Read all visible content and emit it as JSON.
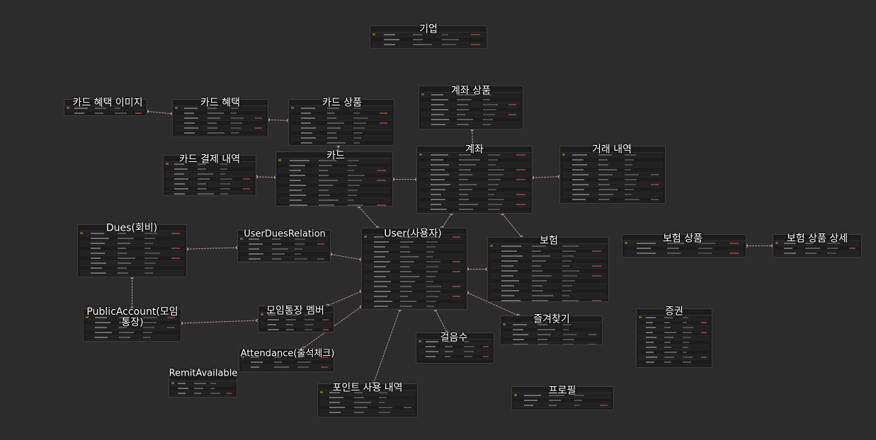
{
  "diagram": {
    "background": "#2c2c2c",
    "entity_color": "#1c1c1c",
    "link_color": "#d9b8b8",
    "entities": [
      {
        "id": "company",
        "label": "기업"
      },
      {
        "id": "card_benefit_image",
        "label": "카드 혜택 이미지"
      },
      {
        "id": "card_benefit",
        "label": "카드 혜택"
      },
      {
        "id": "card_product",
        "label": "카드 상품"
      },
      {
        "id": "account_product",
        "label": "계좌 상품"
      },
      {
        "id": "card_payment",
        "label": "카드 결제 내역"
      },
      {
        "id": "card",
        "label": "카드"
      },
      {
        "id": "account",
        "label": "계좌"
      },
      {
        "id": "transaction",
        "label": "거래 내역"
      },
      {
        "id": "dues",
        "label": "Dues(회비)"
      },
      {
        "id": "user_dues_relation",
        "label": "UserDuesRelation"
      },
      {
        "id": "user",
        "label": "User(사용자)"
      },
      {
        "id": "insurance",
        "label": "보험"
      },
      {
        "id": "insurance_product",
        "label": "보험 상품"
      },
      {
        "id": "insurance_product_detail",
        "label": "보험 상품 상세"
      },
      {
        "id": "public_account",
        "label": "PublicAccount(모임\n통장)"
      },
      {
        "id": "group_member",
        "label": "모임통장 멤버"
      },
      {
        "id": "attendance",
        "label": "Attendance(출석체크)"
      },
      {
        "id": "steps",
        "label": "걸음수"
      },
      {
        "id": "favorites",
        "label": "즐겨찾기"
      },
      {
        "id": "securities",
        "label": "증권"
      },
      {
        "id": "remit_available",
        "label": "RemitAvailable"
      },
      {
        "id": "point_history",
        "label": "포인트 사용 내역"
      },
      {
        "id": "profile",
        "label": "프로필"
      }
    ],
    "relations": [
      [
        "card_benefit_image",
        "card_benefit"
      ],
      [
        "card_benefit",
        "card_product"
      ],
      [
        "card_product",
        "card"
      ],
      [
        "card_payment",
        "card"
      ],
      [
        "card",
        "account"
      ],
      [
        "account_product",
        "account"
      ],
      [
        "account",
        "transaction"
      ],
      [
        "card",
        "user"
      ],
      [
        "account",
        "user"
      ],
      [
        "account",
        "insurance"
      ],
      [
        "insurance_product",
        "insurance_product_detail"
      ],
      [
        "dues",
        "user_dues_relation"
      ],
      [
        "user_dues_relation",
        "user"
      ],
      [
        "dues",
        "public_account"
      ],
      [
        "public_account",
        "group_member"
      ],
      [
        "group_member",
        "user"
      ],
      [
        "user",
        "insurance"
      ],
      [
        "user",
        "favorites"
      ],
      [
        "user",
        "steps"
      ],
      [
        "user",
        "attendance"
      ],
      [
        "user",
        "point_history"
      ]
    ]
  }
}
